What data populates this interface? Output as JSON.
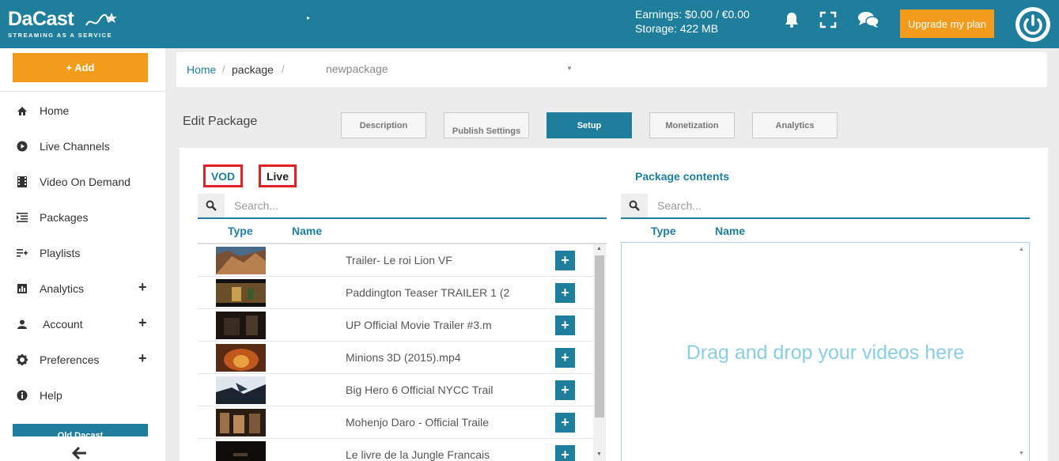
{
  "brand": {
    "name": "DaCast",
    "tagline": "STREAMING AS A SERVICE"
  },
  "header": {
    "earnings": "Earnings: $0.00 / €0.00",
    "storage": "Storage: 422 MB",
    "upgrade_label": "Upgrade my plan"
  },
  "sidebar": {
    "add_label": "+ Add",
    "items": [
      {
        "label": "Home",
        "icon": "home-icon"
      },
      {
        "label": "Live Channels",
        "icon": "play-circle-icon"
      },
      {
        "label": "Video On Demand",
        "icon": "film-icon"
      },
      {
        "label": "Packages",
        "icon": "list-indent-icon"
      },
      {
        "label": "Playlists",
        "icon": "playlist-add-icon"
      },
      {
        "label": "Analytics",
        "icon": "bar-chart-icon"
      },
      {
        "label": "Account",
        "icon": "user-icon"
      },
      {
        "label": "Preferences",
        "icon": "gear-icon"
      },
      {
        "label": "Help",
        "icon": "info-icon"
      }
    ],
    "old_label": "Old Dacast"
  },
  "breadcrumb": {
    "home": "Home",
    "section": "package",
    "current": "newpackage"
  },
  "page": {
    "title": "Edit Package",
    "tabs": [
      "Description",
      "Publish Settings",
      "Setup",
      "Monetization",
      "Analytics"
    ],
    "active_tab": "Setup"
  },
  "source": {
    "vod_label": "VOD",
    "live_label": "Live",
    "search_placeholder": "Search...",
    "col_type": "Type",
    "col_name": "Name",
    "videos": [
      {
        "name": "Trailer- Le roi Lion VF"
      },
      {
        "name": "Paddington Teaser TRAILER 1 (2"
      },
      {
        "name": "UP Official Movie Trailer #3.m"
      },
      {
        "name": "Minions 3D (2015).mp4"
      },
      {
        "name": "Big Hero 6 Official NYCC Trail"
      },
      {
        "name": "Mohenjo Daro - Official Traile"
      },
      {
        "name": "Le livre de la Jungle Francais"
      }
    ]
  },
  "package": {
    "title": "Package contents",
    "search_placeholder": "Search...",
    "col_type": "Type",
    "col_name": "Name",
    "drop_hint": "Drag and drop your videos here"
  },
  "colors": {
    "primary": "#1e7e9c",
    "accent": "#f39c1c",
    "highlight": "#e12025"
  }
}
